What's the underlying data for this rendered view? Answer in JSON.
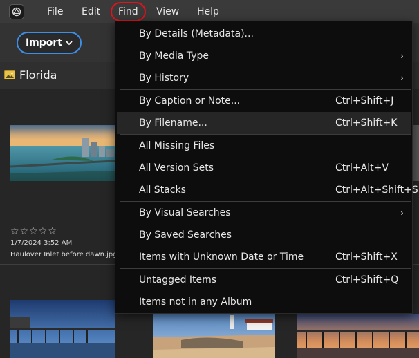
{
  "menubar": {
    "items": [
      {
        "label": "File"
      },
      {
        "label": "Edit"
      },
      {
        "label": "Find"
      },
      {
        "label": "View"
      },
      {
        "label": "Help"
      }
    ]
  },
  "toolbar": {
    "import_label": "Import"
  },
  "album": {
    "title": "Florida"
  },
  "photos": [
    {
      "stars": "☆☆☆☆☆",
      "date": "1/7/2024 3:52 AM",
      "name": "Haulover Inlet before dawn.jpg"
    }
  ],
  "find_menu": {
    "items": [
      {
        "label": "By Details (Metadata)...",
        "shortcut": "",
        "submenu": false
      },
      {
        "label": "By Media Type",
        "shortcut": "",
        "submenu": true
      },
      {
        "label": "By History",
        "shortcut": "",
        "submenu": true
      },
      {
        "label": "By Caption or Note...",
        "shortcut": "Ctrl+Shift+J",
        "submenu": false
      },
      {
        "label": "By Filename...",
        "shortcut": "Ctrl+Shift+K",
        "submenu": false,
        "highlighted": true
      },
      {
        "label": "All Missing Files",
        "shortcut": "",
        "submenu": false
      },
      {
        "label": "All Version Sets",
        "shortcut": "Ctrl+Alt+V",
        "submenu": false
      },
      {
        "label": "All Stacks",
        "shortcut": "Ctrl+Alt+Shift+S",
        "submenu": false
      },
      {
        "label": "By Visual Searches",
        "shortcut": "",
        "submenu": true
      },
      {
        "label": "By Saved Searches",
        "shortcut": "",
        "submenu": false
      },
      {
        "label": "Items with Unknown Date or Time",
        "shortcut": "Ctrl+Shift+X",
        "submenu": false
      },
      {
        "label": "Untagged Items",
        "shortcut": "Ctrl+Shift+Q",
        "submenu": false
      },
      {
        "label": "Items not in any Album",
        "shortcut": "",
        "submenu": false
      }
    ],
    "submenu_arrow": "›"
  },
  "colors": {
    "highlight_ring": "#e3121b",
    "import_border": "#3d8ee6",
    "menu_bg": "#0d0d0d",
    "menu_highlight": "#262626"
  }
}
